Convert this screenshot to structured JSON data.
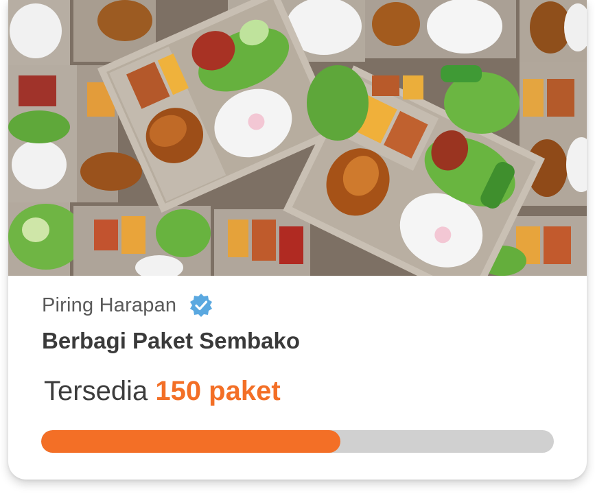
{
  "card": {
    "image_alt": "Paket nasi box",
    "organizer": "Piring Harapan",
    "verified": true,
    "title": "Berbagi Paket Sembako",
    "availability_prefix": "Tersedia",
    "availability_amount": "150 paket",
    "progress": 0.584
  },
  "colors": {
    "accent": "#f36f26",
    "verified_badge": "#5aa8e0",
    "track": "#d0d0d0"
  },
  "icons": {
    "verified": "verified-badge-icon"
  }
}
